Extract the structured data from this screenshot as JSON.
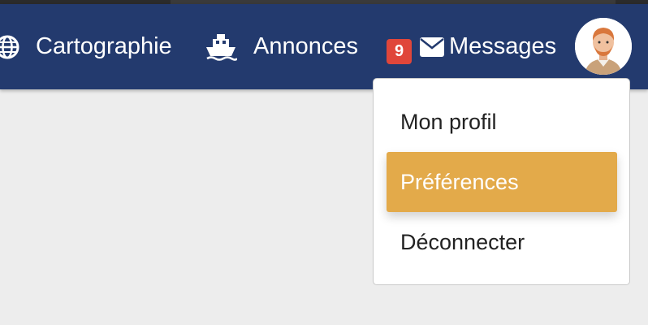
{
  "navbar": {
    "background": "#233a6e",
    "items": [
      {
        "label": "Cartographie",
        "icon": "globe-icon"
      },
      {
        "label": "Annonces",
        "icon": "ship-icon"
      },
      {
        "label": "Messages",
        "icon": "envelope-icon",
        "badge_count": "9"
      }
    ],
    "badge_color": "#e0463a"
  },
  "user": {
    "avatar_icon": "user-avatar-icon"
  },
  "dropdown": {
    "items": [
      {
        "label": "Mon profil",
        "highlighted": false
      },
      {
        "label": "Préférences",
        "highlighted": true
      },
      {
        "label": "Déconnecter",
        "highlighted": false
      }
    ],
    "highlight_color": "#e3aa4a"
  }
}
